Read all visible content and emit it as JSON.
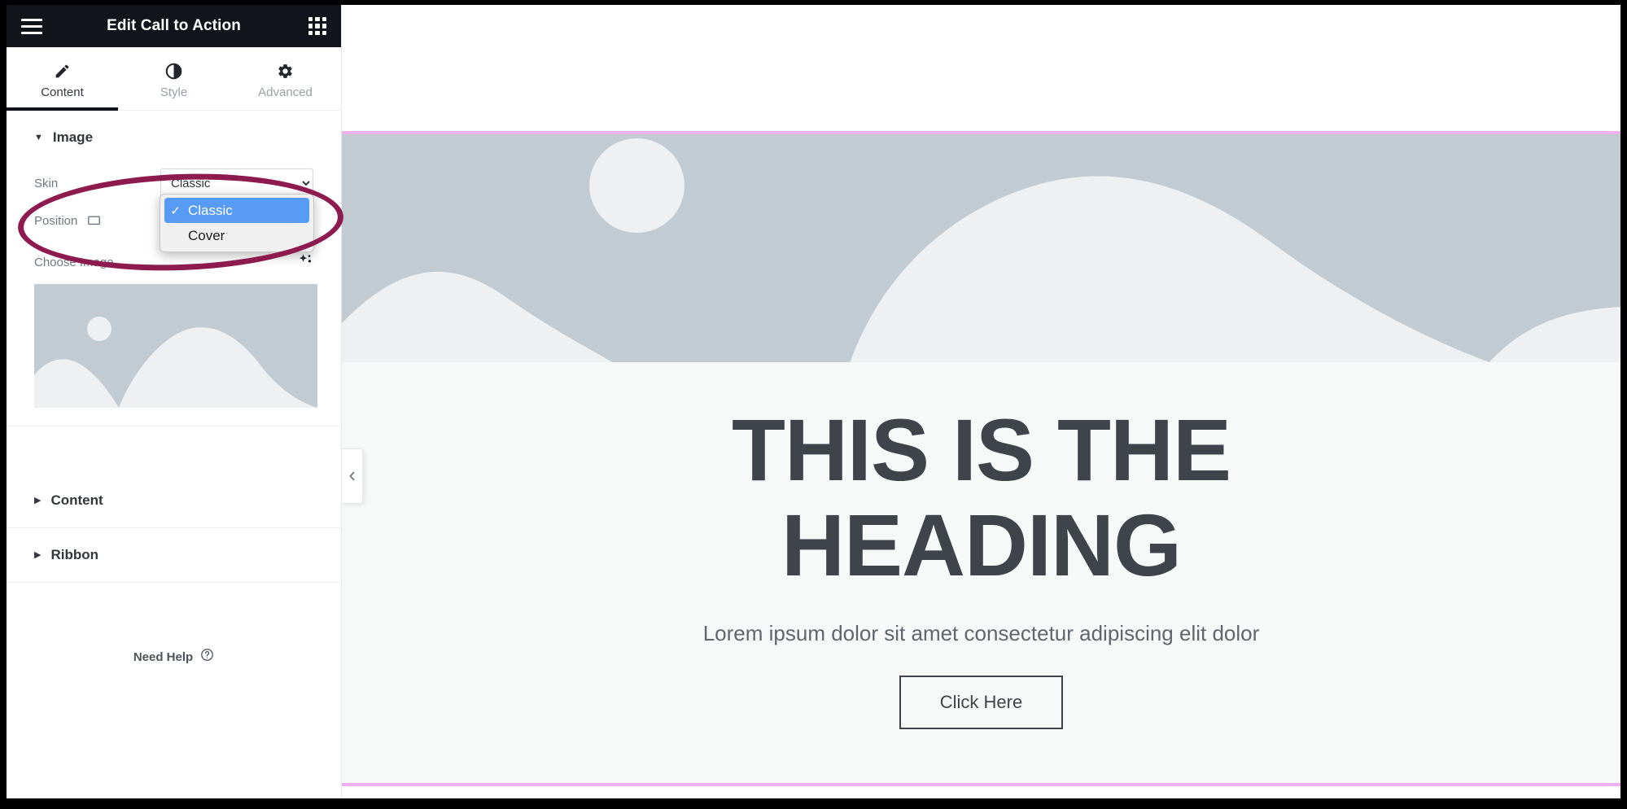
{
  "panel": {
    "header": {
      "title": "Edit Call to Action",
      "menu_icon": "hamburger-icon",
      "apps_icon": "grid-apps-icon"
    },
    "tabs": [
      {
        "label": "Content",
        "icon": "pencil-icon",
        "active": true
      },
      {
        "label": "Style",
        "icon": "contrast-half-circle-icon",
        "active": false
      },
      {
        "label": "Advanced",
        "icon": "gear-icon",
        "active": false
      }
    ],
    "sections": [
      {
        "title": "Image",
        "expanded": true,
        "controls": {
          "skin": {
            "label": "Skin",
            "value": "Classic",
            "options": [
              "Classic",
              "Cover"
            ]
          },
          "position": {
            "label": "Position",
            "device_icon": "desktop-monitor-icon",
            "align_options": [
              "align-left",
              "align-center",
              "align-right"
            ],
            "selected_align": "align-center"
          },
          "choose_image": {
            "label": "Choose Image",
            "ai_icon": "ai-sparkle-icon",
            "thumbnail_alt": "placeholder-landscape-image"
          }
        }
      },
      {
        "title": "Content",
        "expanded": false
      },
      {
        "title": "Ribbon",
        "expanded": false
      }
    ],
    "footer": {
      "need_help_label": "Need Help",
      "help_icon": "question-circle-icon"
    },
    "collapse_handle_icon": "chevron-left-icon"
  },
  "native_dropdown": {
    "visible": true,
    "options": [
      {
        "label": "Classic",
        "selected": true
      },
      {
        "label": "Cover",
        "selected": false
      }
    ],
    "check_glyph": "✓"
  },
  "canvas": {
    "widget": {
      "image_alt": "placeholder-landscape-image",
      "title": "THIS IS THE HEADING",
      "description": "Lorem ipsum dolor sit amet consectetur adipiscing elit dolor",
      "button_label": "Click Here"
    }
  },
  "colors": {
    "header_bg": "#11141a",
    "accent_underline": "#11141a",
    "annotation": "#8e1b4f",
    "dropdown_highlight": "#579bf5",
    "widget_border": "#eeb0ef",
    "placeholder_bg": "#c3cbd2",
    "placeholder_shape": "#eef0f2",
    "heading_text": "#3f444b",
    "panel_bg": "#ffffff"
  }
}
